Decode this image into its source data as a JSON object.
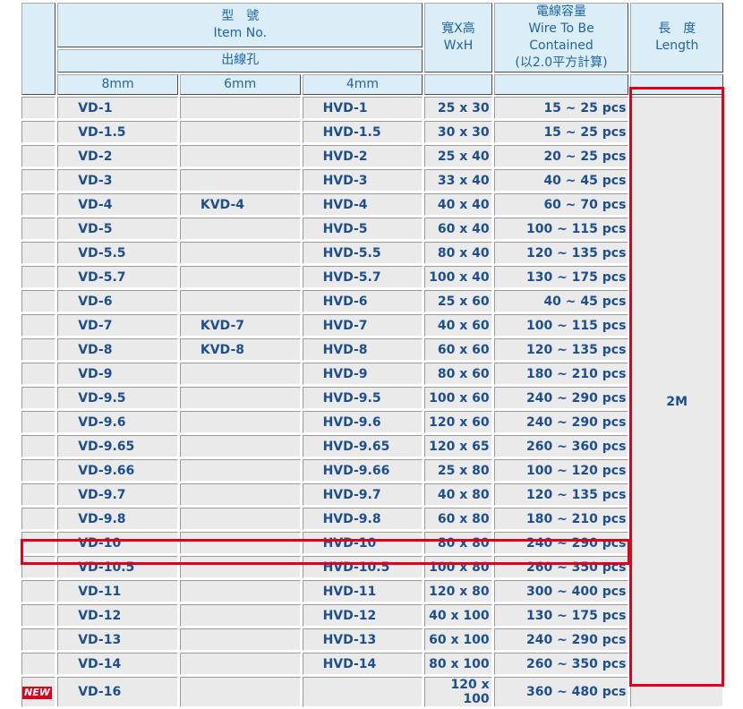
{
  "header": {
    "item_no_zh": "型　號",
    "item_no_en": "Item No.",
    "outlet_zh": "出線孔",
    "size_8": "8mm",
    "size_6": "6mm",
    "size_4": "4mm",
    "wxh_zh": "寬X高",
    "wxh_en": "WxH",
    "wire_zh": "電線容量",
    "wire_en": "Wire To Be Contained",
    "wire_note": "(以2.0平方計算)",
    "length_zh": "長　度",
    "length_en": "Length"
  },
  "length_value": "2M",
  "new_badge": "NEW",
  "highlight_color": "#e0001a",
  "rows": [
    {
      "vd": "VD-1",
      "kvd": "",
      "hvd": "HVD-1",
      "wxh": "25 x 30",
      "wire": "15 ~ 25 pcs"
    },
    {
      "vd": "VD-1.5",
      "kvd": "",
      "hvd": "HVD-1.5",
      "wxh": "30 x 30",
      "wire": "15 ~ 25 pcs"
    },
    {
      "vd": "VD-2",
      "kvd": "",
      "hvd": "HVD-2",
      "wxh": "25 x 40",
      "wire": "20 ~ 25 pcs"
    },
    {
      "vd": "VD-3",
      "kvd": "",
      "hvd": "HVD-3",
      "wxh": "33 x 40",
      "wire": "40 ~ 45 pcs"
    },
    {
      "vd": "VD-4",
      "kvd": "KVD-4",
      "hvd": "HVD-4",
      "wxh": "40 x 40",
      "wire": "60 ~ 70 pcs"
    },
    {
      "vd": "VD-5",
      "kvd": "",
      "hvd": "HVD-5",
      "wxh": "60 x 40",
      "wire": "100 ~ 115 pcs"
    },
    {
      "vd": "VD-5.5",
      "kvd": "",
      "hvd": "HVD-5.5",
      "wxh": "80 x 40",
      "wire": "120 ~ 135 pcs"
    },
    {
      "vd": "VD-5.7",
      "kvd": "",
      "hvd": "HVD-5.7",
      "wxh": "100 x 40",
      "wire": "130 ~ 175 pcs"
    },
    {
      "vd": "VD-6",
      "kvd": "",
      "hvd": "HVD-6",
      "wxh": "25 x 60",
      "wire": "40 ~ 45 pcs"
    },
    {
      "vd": "VD-7",
      "kvd": "KVD-7",
      "hvd": "HVD-7",
      "wxh": "40 x 60",
      "wire": "100 ~ 115 pcs"
    },
    {
      "vd": "VD-8",
      "kvd": "KVD-8",
      "hvd": "HVD-8",
      "wxh": "60 x 60",
      "wire": "120 ~ 135 pcs"
    },
    {
      "vd": "VD-9",
      "kvd": "",
      "hvd": "HVD-9",
      "wxh": "80 x 60",
      "wire": "180 ~ 210 pcs"
    },
    {
      "vd": "VD-9.5",
      "kvd": "",
      "hvd": "HVD-9.5",
      "wxh": "100 x 60",
      "wire": "240 ~ 290 pcs"
    },
    {
      "vd": "VD-9.6",
      "kvd": "",
      "hvd": "HVD-9.6",
      "wxh": "120 x 60",
      "wire": "240 ~ 290 pcs"
    },
    {
      "vd": "VD-9.65",
      "kvd": "",
      "hvd": "HVD-9.65",
      "wxh": "120 x 65",
      "wire": "260 ~ 360 pcs"
    },
    {
      "vd": "VD-9.66",
      "kvd": "",
      "hvd": "HVD-9.66",
      "wxh": "25 x 80",
      "wire": "100 ~ 120 pcs"
    },
    {
      "vd": "VD-9.7",
      "kvd": "",
      "hvd": "HVD-9.7",
      "wxh": "40 x 80",
      "wire": "120 ~ 135 pcs"
    },
    {
      "vd": "VD-9.8",
      "kvd": "",
      "hvd": "HVD-9.8",
      "wxh": "60 x 80",
      "wire": "180 ~ 210 pcs"
    },
    {
      "vd": "VD-10",
      "kvd": "",
      "hvd": "HVD-10",
      "wxh": "80 x 80",
      "wire": "240 ~ 290 pcs"
    },
    {
      "vd": "VD-10.5",
      "kvd": "",
      "hvd": "HVD-10.5",
      "wxh": "100 x 80",
      "wire": "260 ~ 350 pcs"
    },
    {
      "vd": "VD-11",
      "kvd": "",
      "hvd": "HVD-11",
      "wxh": "120 x 80",
      "wire": "300 ~ 400 pcs"
    },
    {
      "vd": "VD-12",
      "kvd": "",
      "hvd": "HVD-12",
      "wxh": "40 x 100",
      "wire": "130 ~ 175 pcs"
    },
    {
      "vd": "VD-13",
      "kvd": "",
      "hvd": "HVD-13",
      "wxh": "60 x 100",
      "wire": "240 ~ 290 pcs"
    },
    {
      "vd": "VD-14",
      "kvd": "",
      "hvd": "HVD-14",
      "wxh": "80 x 100",
      "wire": "260 ~ 350 pcs"
    },
    {
      "vd": "VD-16",
      "kvd": "",
      "hvd": "",
      "wxh": "120 x 100",
      "wire": "360 ~ 480 pcs",
      "is_new": true
    }
  ]
}
